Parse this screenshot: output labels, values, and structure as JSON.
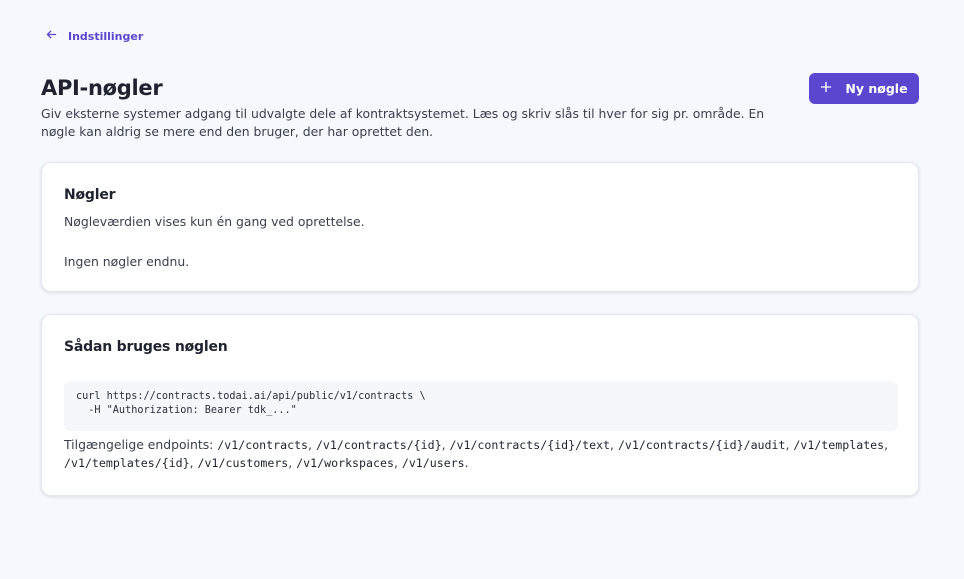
{
  "nav": {
    "back_label": "Indstillinger"
  },
  "header": {
    "title": "API-nøgler",
    "description": "Giv eksterne systemer adgang til udvalgte dele af kontraktsystemet. Læs og skriv slås til hver for sig pr. område. En nøgle kan aldrig se mere end den bruger, der har oprettet den.",
    "new_key_label": "Ny nøgle"
  },
  "keys_card": {
    "title": "Nøgler",
    "subtitle": "Nøgleværdien vises kun én gang ved oprettelse.",
    "empty_text": "Ingen nøgler endnu."
  },
  "usage_card": {
    "title": "Sådan bruges nøglen",
    "code": "curl https://contracts.todai.ai/api/public/v1/contracts \\\n  -H \"Authorization: Bearer tdk_...\"",
    "endpoints_label": "Tilgængelige endpoints:",
    "endpoints": [
      "/v1/contracts",
      "/v1/contracts/{id}",
      "/v1/contracts/{id}/text",
      "/v1/contracts/{id}/audit",
      "/v1/templates",
      "/v1/templates/{id}",
      "/v1/customers",
      "/v1/workspaces",
      "/v1/users"
    ]
  },
  "colors": {
    "accent": "#5b47cf",
    "background": "#f5f8fc",
    "card": "#ffffff"
  },
  "icons": {
    "back": "arrow-left-icon",
    "add": "plus-icon"
  }
}
